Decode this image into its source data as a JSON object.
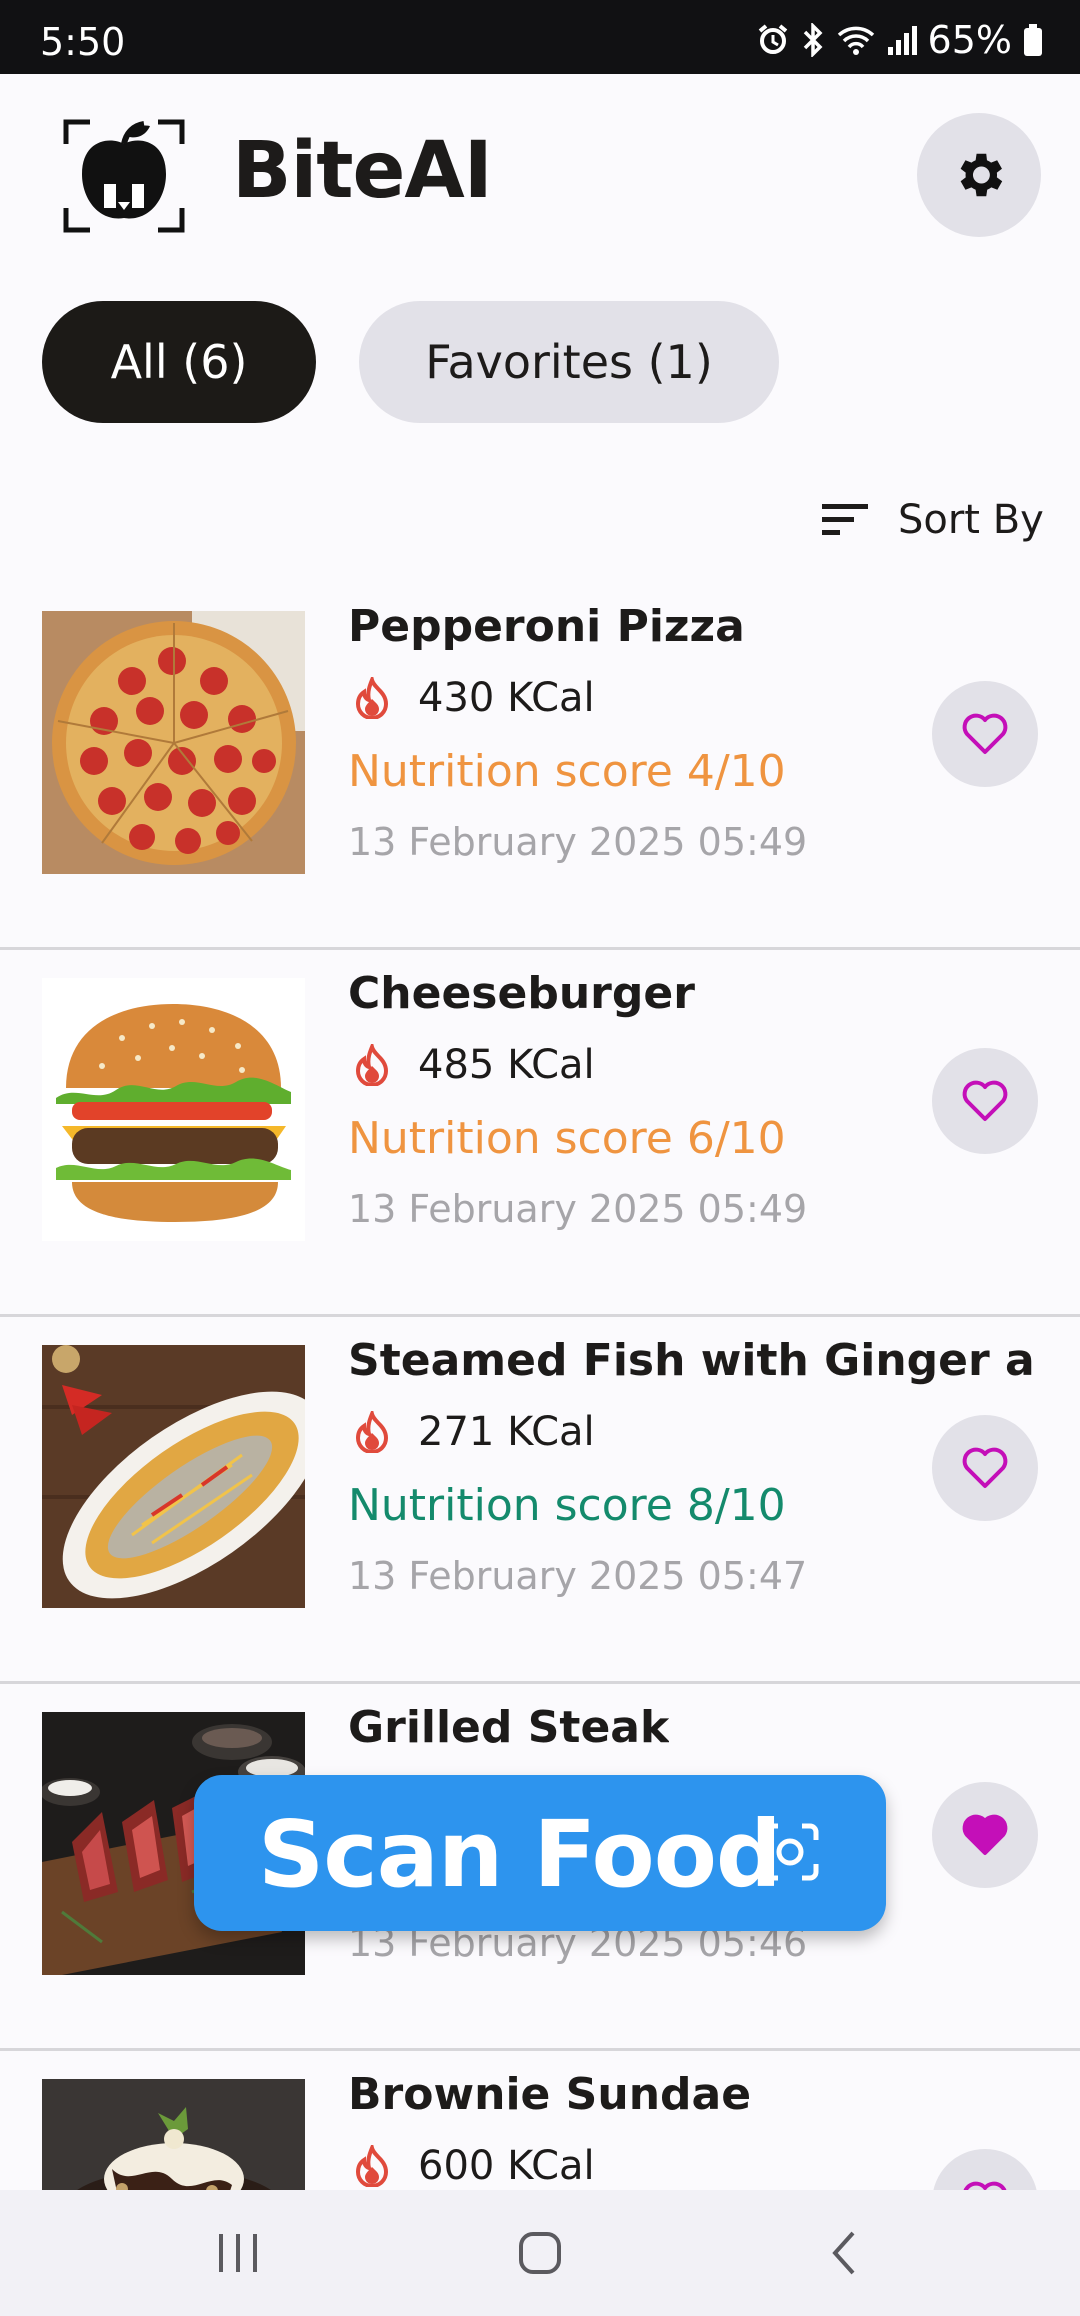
{
  "status_bar": {
    "time": "5:50",
    "battery": "65%",
    "icons": [
      "alarm-icon",
      "bluetooth-icon",
      "wifi-icon",
      "signal-icon",
      "battery-icon"
    ]
  },
  "header": {
    "title": "BiteAI",
    "logo_icon": "apple-scan-logo",
    "settings_icon": "gear-icon"
  },
  "filters": [
    {
      "label": "All (6)",
      "selected": true
    },
    {
      "label": "Favorites (1)",
      "selected": false
    }
  ],
  "sort": {
    "label": "Sort By",
    "icon": "sort-icon"
  },
  "items": [
    {
      "name": "Pepperoni Pizza",
      "calories": "430 KCal",
      "score": "Nutrition score 4/10",
      "date": "13 February 2025 05:49",
      "favorite": false
    },
    {
      "name": "Cheeseburger",
      "calories": "485 KCal",
      "score": "Nutrition score 6/10",
      "date": "13 February 2025 05:49",
      "favorite": false
    },
    {
      "name": "Steamed Fish with Ginger and...",
      "calories": "271 KCal",
      "score": "Nutrition score 8/10",
      "date": "13 February 2025 05:47",
      "favorite": false
    },
    {
      "name": "Grilled Steak",
      "calories": "",
      "score": "",
      "date": "13 February 2025 05:46",
      "favorite": true
    },
    {
      "name": "Brownie Sundae",
      "calories": "600 KCal",
      "score": "",
      "date": "",
      "favorite": false
    }
  ],
  "scan_button": {
    "label": "Scan Food",
    "icon": "scan-icon"
  },
  "colors": {
    "accent": "#2d94ee",
    "score_mid": "#ef9440",
    "score_good": "#148a6c",
    "heart": "#c40fb8",
    "flame": "#e04a3c",
    "chip_active": "#1c1a17",
    "chip_inactive": "#e2e1e8"
  },
  "nav": {
    "icons": [
      "recent-apps-icon",
      "home-icon",
      "back-icon"
    ]
  }
}
